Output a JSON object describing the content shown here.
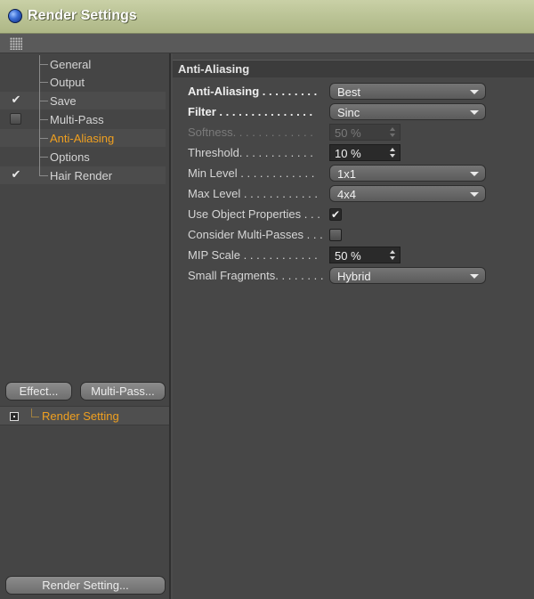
{
  "window": {
    "title": "Render Settings"
  },
  "tree": [
    {
      "label": "General",
      "marker": "none",
      "active": false
    },
    {
      "label": "Output",
      "marker": "none",
      "active": false
    },
    {
      "label": "Save",
      "marker": "check",
      "active": false
    },
    {
      "label": "Multi-Pass",
      "marker": "box",
      "active": false
    },
    {
      "label": "Anti-Aliasing",
      "marker": "none",
      "active": true
    },
    {
      "label": "Options",
      "marker": "none",
      "active": false
    },
    {
      "label": "Hair Render",
      "marker": "check",
      "active": false
    }
  ],
  "buttons": {
    "effect": "Effect...",
    "multipass": "Multi-Pass...",
    "render_setting": "Render Setting..."
  },
  "render_setting_item": {
    "label": "Render Setting"
  },
  "check_glyph": "✔",
  "section": {
    "title": "Anti-Aliasing"
  },
  "props": {
    "anti_aliasing": {
      "label": "Anti-Aliasing . . . . . . . . .",
      "value": "Best"
    },
    "filter": {
      "label": "Filter . . . . . . . . . . . . . . .",
      "value": "Sinc"
    },
    "softness": {
      "label": "Softness. . . . . . . . . . . . .",
      "value": "50 %"
    },
    "threshold": {
      "label": "Threshold. . . . . . . . . . . .",
      "value": "10 %"
    },
    "min_level": {
      "label": "Min Level . . . . . . . . . . . .",
      "value": "1x1"
    },
    "max_level": {
      "label": "Max Level . . . . . . . . . . . .",
      "value": "4x4"
    },
    "use_object_properties": {
      "label": "Use Object Properties . . .",
      "checked": true
    },
    "consider_multipasses": {
      "label": "Consider Multi-Passes . . .",
      "checked": false
    },
    "mip_scale": {
      "label": "MIP Scale . . . . . . . . . . . .",
      "value": "50 %"
    },
    "small_fragments": {
      "label": "Small Fragments. . . . . . . .",
      "value": "Hybrid"
    }
  },
  "colors": {
    "accent": "#f0a020",
    "titlebar": "#b9c294",
    "panel": "#474747"
  },
  "icons": {
    "window": "app-orb-icon",
    "toolbar": "grip-icon",
    "checked": "checkmark-icon",
    "unchecked": "checkbox-icon",
    "render": "target-icon"
  }
}
